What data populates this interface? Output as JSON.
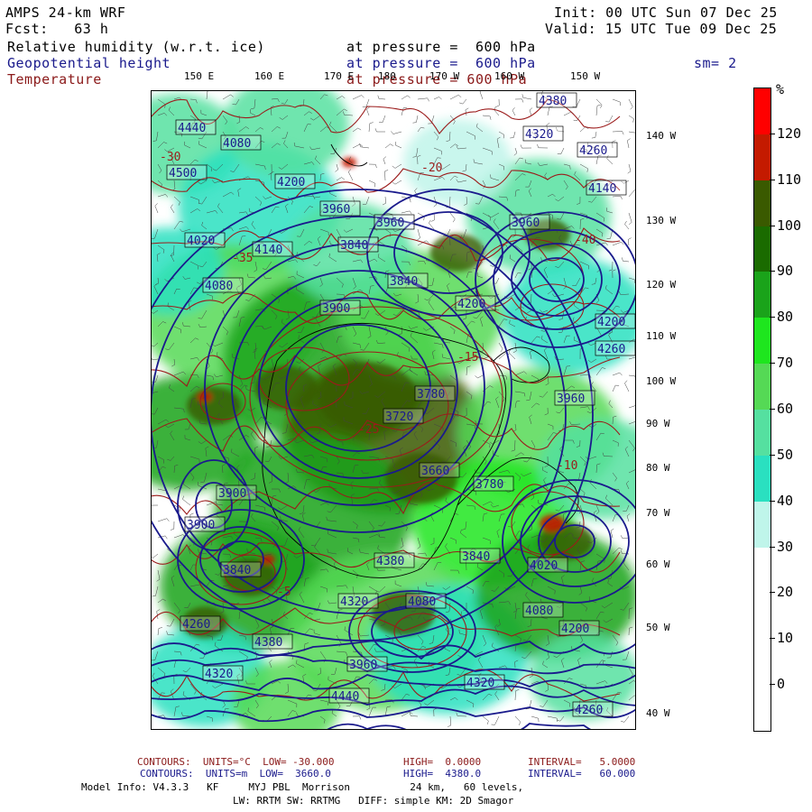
{
  "header": {
    "model": "AMPS 24-km WRF",
    "init": "Init: 00 UTC Sun 07 Dec 25",
    "fcst": "Fcst:   63 h",
    "valid": "Valid: 15 UTC Tue 09 Dec 25",
    "field1": "Relative humidity (w.r.t. ice)",
    "field1_level": "at pressure =  600 hPa",
    "field2": "Geopotential height",
    "field2_level": "at pressure =  600 hPa",
    "smooth": "sm= 2",
    "field3": "Temperature",
    "field3_level": "at pressure = 600 hPa"
  },
  "colors": {
    "header_text": "#000000",
    "height_text": "#1a1a8c",
    "temp_text": "#8b1a1a",
    "height_contour": "#1a1a8c",
    "temp_contour": "#9b1b1b"
  },
  "lon_labels": [
    "150 E",
    "160 E",
    "170 E",
    "180",
    "170 W",
    "160 W",
    "150 W"
  ],
  "lat_labels": [
    "140 W",
    "130 W",
    "120 W",
    "110 W",
    "100 W",
    "90 W",
    "80 W",
    "70 W",
    "60 W",
    "50 W",
    "40 W"
  ],
  "colorbar": {
    "unit": "%",
    "labels": [
      "120",
      "110",
      "100",
      "90",
      "80",
      "70",
      "60",
      "50",
      "40",
      "30",
      "20",
      "10",
      "0"
    ],
    "colors": [
      "#ff0000",
      "#c41a00",
      "#3a5a00",
      "#1a6b00",
      "#1aa31a",
      "#1ee61e",
      "#55d955",
      "#55e0a0",
      "#2ae0c0",
      "#bff5ea",
      "#ffffff",
      "#ffffff",
      "#ffffff",
      "#ffffff"
    ]
  },
  "height_labels": [
    "4380",
    "4320",
    "4260",
    "4440",
    "4140",
    "4500",
    "4080",
    "4200",
    "4020",
    "3960",
    "3960",
    "3840",
    "4080",
    "3960",
    "4140",
    "4200",
    "3840",
    "3900",
    "3780",
    "3720",
    "3660",
    "3780",
    "3840",
    "3900",
    "4020",
    "4080",
    "4200",
    "4260",
    "4320",
    "4380",
    "4440",
    "4380",
    "4320",
    "4260",
    "4200",
    "4260",
    "4320",
    "3960",
    "4080",
    "3900",
    "3840",
    "3960"
  ],
  "temp_labels": [
    "-30",
    "-25",
    "-20",
    "-15",
    "-10",
    "-5",
    "-35",
    "-40"
  ],
  "footer": {
    "line1_a": "CONTOURS:  UNITS=°C  LOW= -30.000",
    "line1_b": "HIGH=  0.0000",
    "line1_c": "INTERVAL=   5.0000",
    "line2_a": "CONTOURS:  UNITS=m  LOW=  3660.0",
    "line2_b": "HIGH=  4380.0",
    "line2_c": "INTERVAL=   60.000",
    "line3": "Model Info: V4.3.3   KF     MYJ PBL  Morrison          24 km,   60 levels,",
    "line4": "LW: RRTM SW: RRTMG   DIFF: simple KM: 2D Smagor"
  }
}
